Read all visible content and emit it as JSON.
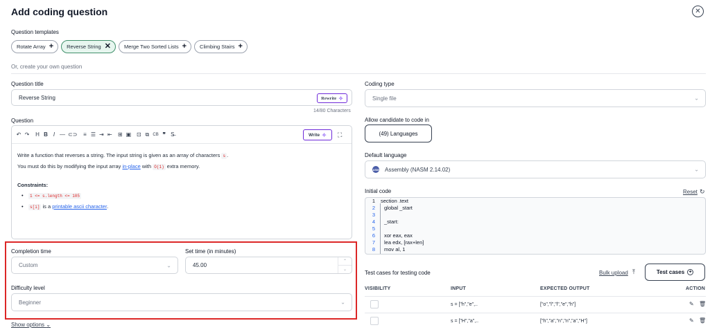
{
  "header": {
    "title": "Add coding question",
    "close_icon": "close-icon"
  },
  "templates": {
    "label": "Question templates",
    "items": [
      {
        "label": "Rotate Array",
        "active": false,
        "icon": "+"
      },
      {
        "label": "Reverse String",
        "active": true,
        "icon": "✕"
      },
      {
        "label": "Merge Two Sorted Lists",
        "active": false,
        "icon": "+"
      },
      {
        "label": "Climbing Stairs",
        "active": false,
        "icon": "+"
      }
    ],
    "or_create": "Or, create your own question"
  },
  "question_title": {
    "label": "Question title",
    "value": "Reverse String",
    "rewrite_label": "Rewrite",
    "char_count": "14/80 Characters"
  },
  "question": {
    "label": "Question",
    "write_label": "Write",
    "body": {
      "line1_pre": "Write a function that reverses a string. The input string is given as an array of characters",
      "line1_code": "s",
      "line1_post": ".",
      "line2_pre": "You must do this by modifying the input array",
      "line2_link": "in-place",
      "line2_mid": "with",
      "line2_code": "O(1)",
      "line2_post": "extra memory.",
      "constraints_label": "Constraints:",
      "c1_code": "1 <= s.length <= 105",
      "c2_code": "s[i]",
      "c2_mid": "is a",
      "c2_link": "printable ascii character",
      "c2_post": "."
    }
  },
  "completion": {
    "label": "Completion time",
    "value": "Custom",
    "set_time_label": "Set time (in minutes)",
    "set_time_value": "45.00"
  },
  "difficulty": {
    "label": "Difficulty level",
    "value": "Beginner"
  },
  "show_options": "Show options",
  "coding_type": {
    "label": "Coding type",
    "value": "Single file"
  },
  "allow_candidate": {
    "label": "Allow candidate to code in",
    "button": "(49) Languages"
  },
  "default_language": {
    "label": "Default language",
    "value": "Assembly (NASM 2.14.02)"
  },
  "initial_code": {
    "label": "Initial code",
    "reset_label": "Reset",
    "lines": [
      {
        "n": "1",
        "text": "section .text"
      },
      {
        "n": "2",
        "text": "global _start"
      },
      {
        "n": "3",
        "text": ""
      },
      {
        "n": "4",
        "text": "_start:"
      },
      {
        "n": "5",
        "text": ""
      },
      {
        "n": "6",
        "text": "xor eax, eax"
      },
      {
        "n": "7",
        "text": "lea edx, [rax+len]"
      },
      {
        "n": "8",
        "text": "mov al, 1"
      }
    ]
  },
  "test_cases": {
    "label": "Test cases for testing code",
    "bulk_upload": "Bulk upload",
    "button": "Test cases",
    "columns": [
      "VISIBILITY",
      "INPUT",
      "EXPECTED OUTPUT",
      "ACTION"
    ],
    "rows": [
      {
        "input": "s = [\"h\",\"e\",..",
        "output": "[\"o\",\"l\",\"l\",\"e\",\"h\"]"
      },
      {
        "input": "s = [\"H\",\"a\",..",
        "output": "[\"h\",\"a\",\"n\",\"n\",\"a\",\"H\"]"
      }
    ]
  },
  "colors": {
    "accent": "#6d28d9",
    "highlight_border": "#dc2626",
    "active_chip": "#e7f6ef",
    "link": "#2563eb"
  }
}
